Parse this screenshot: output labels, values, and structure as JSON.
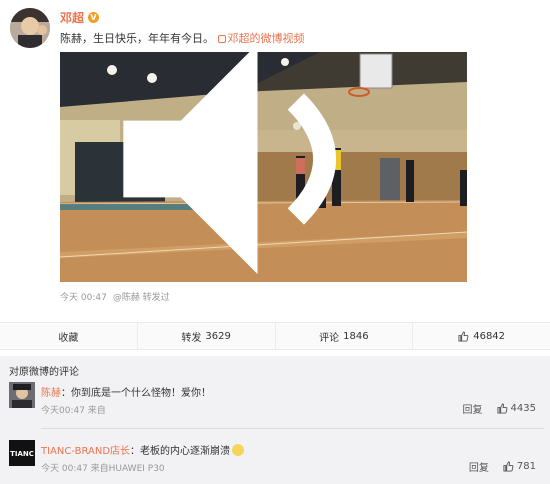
{
  "post": {
    "author": "邓超",
    "text_main": "陈赫，生日快乐，年年有今日。",
    "video_link_label": "邓超的微博视频",
    "meta_time": "今天 00:47",
    "meta_via": "@陈赫 转发过"
  },
  "actions": {
    "favorite_label": "收藏",
    "repost_label": "转发",
    "repost_count": "3629",
    "comment_label": "评论",
    "comment_count": "1846",
    "like_count": "46842"
  },
  "comments": {
    "title": "对原微博的评论",
    "items": [
      {
        "name": "陈赫",
        "text": "：你到底是一个什么怪物！爱你！",
        "meta": "今天00:47 来自",
        "reply_label": "回复",
        "likes": "4435"
      },
      {
        "name": "TIANC-BRAND店长",
        "text": "：老板的内心逐渐崩溃",
        "avatar_text": "TIANC",
        "meta": "今天 00:47 来自HUAWEI P30",
        "reply_label": "回复",
        "likes": "781"
      }
    ]
  },
  "colors": {
    "accent": "#eb7350",
    "badge": "#f29c24",
    "comment_bg": "#f2f2f5"
  }
}
